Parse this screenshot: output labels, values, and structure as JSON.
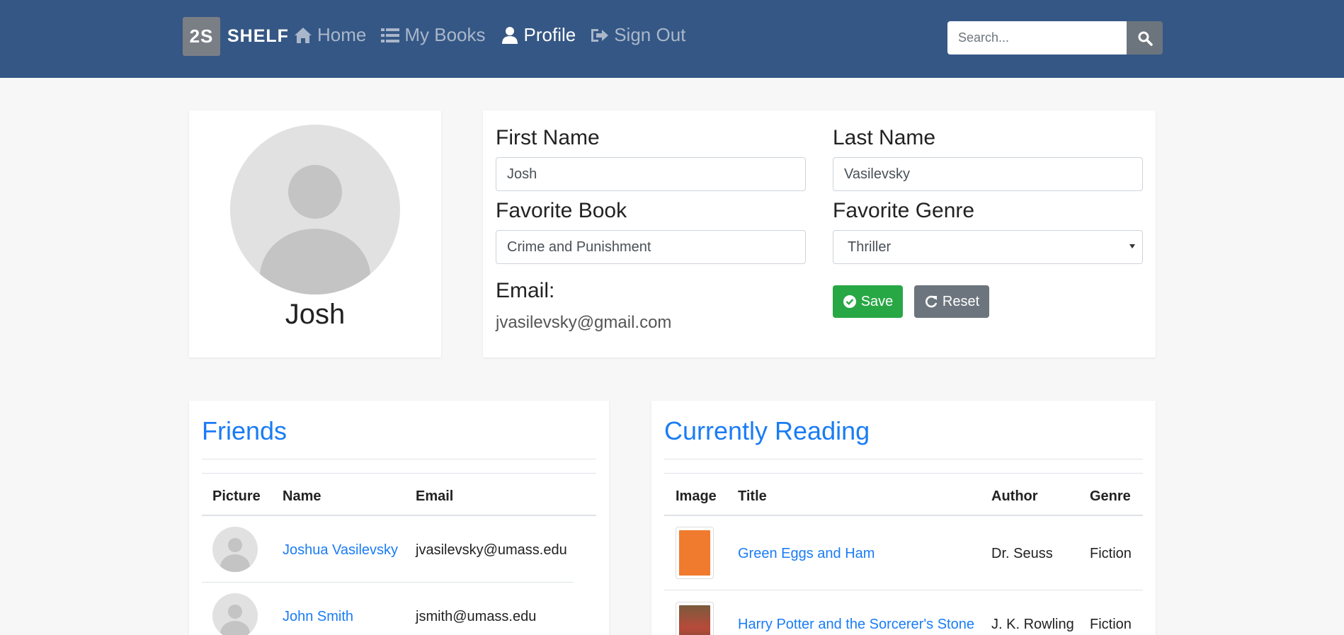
{
  "nav": {
    "brand_logo": "2S",
    "brand_name": "SHELF",
    "links": [
      {
        "label": "Home",
        "icon": "home-icon"
      },
      {
        "label": "My Books",
        "icon": "list-icon"
      },
      {
        "label": "Profile",
        "icon": "user-icon",
        "active": true
      },
      {
        "label": "Sign Out",
        "icon": "sign-out-icon"
      }
    ],
    "search_placeholder": "Search..."
  },
  "profile": {
    "name": "Josh",
    "first_name_label": "First Name",
    "first_name": "Josh",
    "last_name_label": "Last Name",
    "last_name": "Vasilevsky",
    "favorite_book_label": "Favorite Book",
    "favorite_book": "Crime and Punishment",
    "favorite_genre_label": "Favorite Genre",
    "favorite_genre": "Thriller",
    "email_label": "Email:",
    "email": "jvasilevsky@gmail.com",
    "save_label": "Save",
    "reset_label": "Reset"
  },
  "friends": {
    "title": "Friends",
    "columns": [
      "Picture",
      "Name",
      "Email"
    ],
    "rows": [
      {
        "name": "Joshua Vasilevsky",
        "email": "jvasilevsky@umass.edu"
      },
      {
        "name": "John Smith",
        "email": "jsmith@umass.edu"
      }
    ]
  },
  "reading": {
    "title": "Currently Reading",
    "columns": [
      "Image",
      "Title",
      "Author",
      "Genre"
    ],
    "rows": [
      {
        "title": "Green Eggs and Ham",
        "author": "Dr. Seuss",
        "genre": "Fiction"
      },
      {
        "title": "Harry Potter and the Sorcerer's Stone",
        "author": "J. K. Rowling",
        "genre": "Fiction"
      }
    ]
  },
  "colors": {
    "navbar": "#355785",
    "link": "#1a7cf5",
    "save": "#28a745",
    "reset": "#6c757d"
  }
}
